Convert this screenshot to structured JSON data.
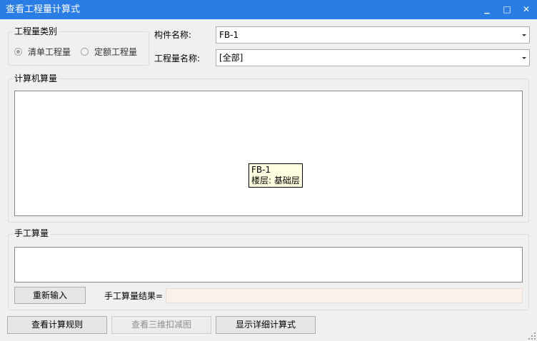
{
  "window": {
    "title": "查看工程量计算式",
    "minimize_glyph": "▁",
    "maximize_glyph": "□",
    "close_glyph": "✕"
  },
  "quantity_type": {
    "legend": "工程量类别",
    "options": [
      {
        "label": "清单工程量",
        "checked": true
      },
      {
        "label": "定额工程量",
        "checked": false
      }
    ]
  },
  "component": {
    "label": "构件名称:",
    "value": "FB-1"
  },
  "quantity_name": {
    "label": "工程量名称:",
    "value": "[全部]"
  },
  "computer_calc": {
    "legend": "计算机算量",
    "tooltip": {
      "line1": "FB-1",
      "line2": "楼层: 基础层"
    }
  },
  "manual_calc": {
    "legend": "手工算量",
    "reenter_button": "重新输入",
    "result_label": "手工算量结果=",
    "result_value": ""
  },
  "footer": {
    "view_rules": "查看计算规则",
    "view_3d": "查看三维扣减图",
    "show_detail": "显示详细计算式"
  },
  "colors": {
    "titlebar": "#2b7de6",
    "tooltip_bg": "#ffffe1",
    "result_field_bg": "#fbf1ea"
  },
  "icons": [
    "minimize-icon",
    "maximize-icon",
    "close-icon",
    "chevron-down-icon",
    "resize-grip-icon"
  ]
}
